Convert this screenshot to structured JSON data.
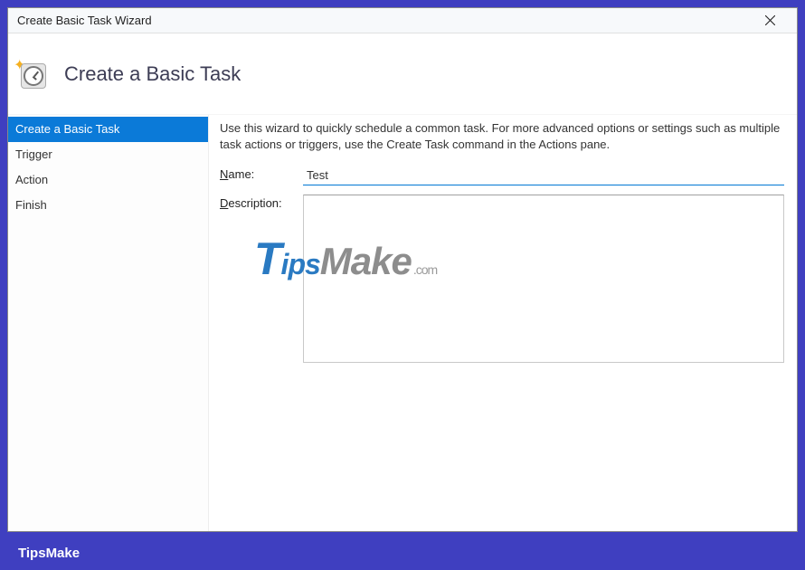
{
  "window": {
    "title": "Create Basic Task Wizard"
  },
  "header": {
    "title": "Create a Basic Task"
  },
  "sidebar": {
    "items": [
      {
        "label": "Create a Basic Task",
        "selected": true
      },
      {
        "label": "Trigger",
        "selected": false
      },
      {
        "label": "Action",
        "selected": false
      },
      {
        "label": "Finish",
        "selected": false
      }
    ]
  },
  "main": {
    "instruction": "Use this wizard to quickly schedule a common task.  For more advanced options or settings such as multiple task actions or triggers, use the Create Task command in the Actions pane.",
    "name_label_prefix": "N",
    "name_label_rest": "ame:",
    "name_value": "Test",
    "desc_label_prefix": "D",
    "desc_label_rest": "escription:",
    "desc_value": ""
  },
  "footer": {
    "brand": "TipsMake"
  },
  "watermark": {
    "text": "TipsMake",
    "suffix": ".com"
  }
}
